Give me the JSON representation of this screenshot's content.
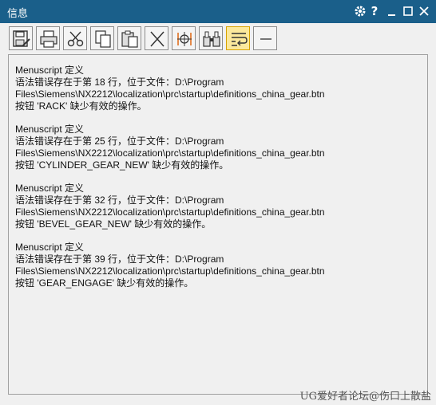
{
  "window": {
    "title": "信息",
    "controls": {
      "settings_icon": "gear-icon",
      "help_icon": "question-icon",
      "minimize_icon": "minimize-icon",
      "maximize_icon": "maximize-icon",
      "close_icon": "close-icon"
    }
  },
  "toolbar": {
    "buttons": [
      {
        "icon": "save-icon"
      },
      {
        "icon": "print-icon"
      },
      {
        "icon": "cut-icon"
      },
      {
        "icon": "copy-icon"
      },
      {
        "icon": "paste-icon"
      },
      {
        "icon": "clear-icon"
      },
      {
        "icon": "target-icon"
      },
      {
        "icon": "find-icon"
      },
      {
        "icon": "word-wrap-icon",
        "active": true
      },
      {
        "icon": "dash-icon"
      }
    ],
    "active_color": "#fbe89c"
  },
  "messages": [
    {
      "header": "Menuscript 定义",
      "line1": "语法错误存在于第 18 行，位于文件：D:\\Program",
      "line2": "Files\\Siemens\\NX2212\\localization\\prc\\startup\\definitions_china_gear.btn",
      "line3": "按钮 'RACK' 缺少有效的操作。"
    },
    {
      "header": "Menuscript 定义",
      "line1": "语法错误存在于第 25 行，位于文件：D:\\Program",
      "line2": "Files\\Siemens\\NX2212\\localization\\prc\\startup\\definitions_china_gear.btn",
      "line3": "按钮 'CYLINDER_GEAR_NEW' 缺少有效的操作。"
    },
    {
      "header": "Menuscript 定义",
      "line1": "语法错误存在于第 32 行，位于文件：D:\\Program",
      "line2": "Files\\Siemens\\NX2212\\localization\\prc\\startup\\definitions_china_gear.btn",
      "line3": "按钮 'BEVEL_GEAR_NEW' 缺少有效的操作。"
    },
    {
      "header": "Menuscript 定义",
      "line1": "语法错误存在于第 39 行，位于文件：D:\\Program",
      "line2": "Files\\Siemens\\NX2212\\localization\\prc\\startup\\definitions_china_gear.btn",
      "line3": "按钮 'GEAR_ENGAGE' 缺少有效的操作。"
    }
  ],
  "watermark": "UG爱好者论坛@伤口上散盐",
  "colors": {
    "titlebar": "#1a5f8a",
    "background": "#f0f0f0"
  }
}
